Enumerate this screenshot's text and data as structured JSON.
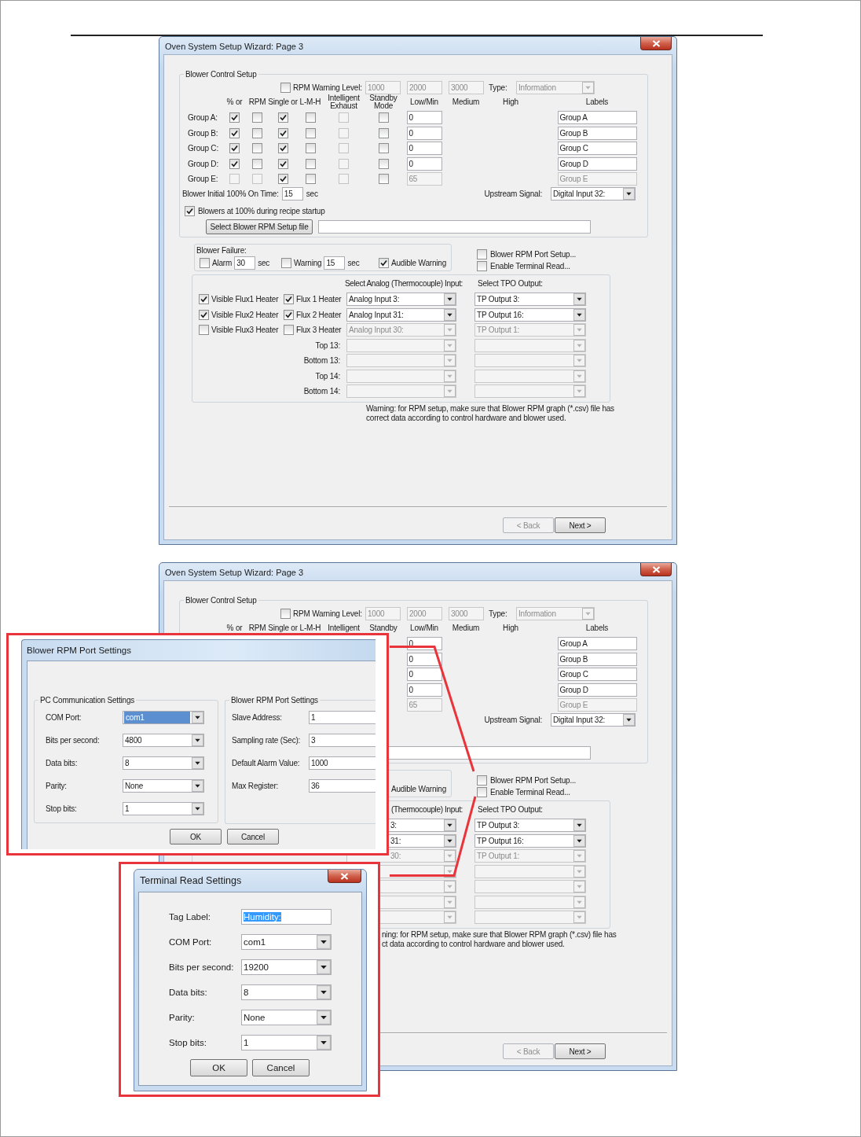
{
  "wizards": [
    {
      "title": "Oven System Setup Wizard: Page 3",
      "blower_control": {
        "legend": "Blower Control Setup",
        "rpm_warning": {
          "checked": false,
          "label": "RPM Warning Level:",
          "levels": [
            {
              "value": "1000",
              "disabled": true
            },
            {
              "value": "2000",
              "disabled": true
            },
            {
              "value": "3000",
              "disabled": true
            }
          ],
          "type_label": "Type:",
          "type_value": {
            "value": "Information",
            "disabled": true
          }
        },
        "headers": [
          "% or",
          "RPM",
          "Single or",
          "L-M-H",
          "Intelligent Exhaust",
          "Standby Mode",
          "Low/Min",
          "Medium",
          "High",
          "Labels"
        ],
        "groups": [
          {
            "name": "Group A:",
            "checks": [
              {
                "checked": true,
                "disabled": false
              },
              {
                "checked": false,
                "disabled": false
              },
              {
                "checked": true,
                "disabled": false
              },
              {
                "checked": false,
                "disabled": false
              },
              {
                "checked": false,
                "disabled": true
              },
              {
                "checked": false,
                "disabled": false
              }
            ],
            "low": {
              "value": "0",
              "disabled": false
            },
            "label": {
              "value": "Group A",
              "disabled": false
            }
          },
          {
            "name": "Group B:",
            "checks": [
              {
                "checked": true,
                "disabled": false
              },
              {
                "checked": false,
                "disabled": false
              },
              {
                "checked": true,
                "disabled": false
              },
              {
                "checked": false,
                "disabled": false
              },
              {
                "checked": false,
                "disabled": true
              },
              {
                "checked": false,
                "disabled": false
              }
            ],
            "low": {
              "value": "0",
              "disabled": false
            },
            "label": {
              "value": "Group B",
              "disabled": false
            }
          },
          {
            "name": "Group C:",
            "checks": [
              {
                "checked": true,
                "disabled": false
              },
              {
                "checked": false,
                "disabled": false
              },
              {
                "checked": true,
                "disabled": false
              },
              {
                "checked": false,
                "disabled": false
              },
              {
                "checked": false,
                "disabled": true
              },
              {
                "checked": false,
                "disabled": false
              }
            ],
            "low": {
              "value": "0",
              "disabled": false
            },
            "label": {
              "value": "Group C",
              "disabled": false
            }
          },
          {
            "name": "Group D:",
            "checks": [
              {
                "checked": true,
                "disabled": false
              },
              {
                "checked": false,
                "disabled": false
              },
              {
                "checked": true,
                "disabled": false
              },
              {
                "checked": false,
                "disabled": false
              },
              {
                "checked": false,
                "disabled": true
              },
              {
                "checked": false,
                "disabled": false
              }
            ],
            "low": {
              "value": "0",
              "disabled": false
            },
            "label": {
              "value": "Group D",
              "disabled": false
            }
          },
          {
            "name": "Group E:",
            "checks": [
              {
                "checked": false,
                "disabled": true
              },
              {
                "checked": false,
                "disabled": true
              },
              {
                "checked": true,
                "disabled": false
              },
              {
                "checked": false,
                "disabled": false
              },
              {
                "checked": false,
                "disabled": true
              },
              {
                "checked": false,
                "disabled": false
              }
            ],
            "low": {
              "value": "65",
              "disabled": true
            },
            "label": {
              "value": "Group E",
              "disabled": true
            }
          }
        ],
        "initial_time": {
          "label": "Blower Initial 100% On Time:",
          "value": "15",
          "unit": "sec"
        },
        "upstream": {
          "label": "Upstream Signal:",
          "value": "Digital Input  32:"
        },
        "startup": {
          "checked": true,
          "label": "Blowers at 100% during recipe startup"
        },
        "setup_file_button": "Select Blower RPM Setup file"
      },
      "blower_failure": {
        "title": "Blower Failure:",
        "alarm": {
          "checked": false,
          "label": "Alarm",
          "value": "30",
          "unit": "sec"
        },
        "warning": {
          "checked": false,
          "label": "Warning",
          "value": "15",
          "unit": "sec"
        },
        "audible": {
          "checked": true,
          "label": "Audible Warning"
        }
      },
      "port_options": [
        {
          "checked": false,
          "label": "Blower RPM Port Setup..."
        },
        {
          "checked": false,
          "label": "Enable Terminal Read..."
        }
      ],
      "heaters": {
        "analog_header": "Select Analog (Thermocouple) Input:",
        "tpo_header": "Select TPO Output:",
        "rows": [
          {
            "visible": {
              "checked": true,
              "label": "Visible Flux1 Heater"
            },
            "flux": {
              "checked": true,
              "label": "Flux 1 Heater"
            },
            "analog": {
              "value": "Analog Input 3:",
              "disabled": false
            },
            "tpo": {
              "value": "TP Output 3:",
              "disabled": false
            }
          },
          {
            "visible": {
              "checked": true,
              "label": "Visible Flux2 Heater"
            },
            "flux": {
              "checked": true,
              "label": "Flux 2 Heater"
            },
            "analog": {
              "value": "Analog Input 31:",
              "disabled": false
            },
            "tpo": {
              "value": "TP Output 16:",
              "disabled": false
            }
          },
          {
            "visible": {
              "checked": false,
              "label": "Visible Flux3 Heater"
            },
            "flux": {
              "checked": false,
              "label": "Flux 3 Heater"
            },
            "analog": {
              "value": "Analog Input 30:",
              "disabled": true
            },
            "tpo": {
              "value": "TP Output 1:",
              "disabled": true
            }
          },
          {
            "label": "Top 13:",
            "analog": {
              "disabled": true
            },
            "tpo": {
              "disabled": true
            }
          },
          {
            "label": "Bottom 13:",
            "analog": {
              "disabled": true
            },
            "tpo": {
              "disabled": true
            }
          },
          {
            "label": "Top 14:",
            "analog": {
              "disabled": true
            },
            "tpo": {
              "disabled": true
            }
          },
          {
            "label": "Bottom 14:",
            "analog": {
              "disabled": true
            },
            "tpo": {
              "disabled": true
            }
          }
        ]
      },
      "warning_lines": [
        "Warning: for RPM setup, make sure that Blower RPM graph (*.csv) file has",
        "correct data according to control hardware and blower used."
      ],
      "buttons": [
        {
          "label": "< Back",
          "disabled": true
        },
        {
          "label": "Next >",
          "disabled": false
        }
      ]
    },
    {
      "title": "Oven System Setup Wizard: Page 3",
      "blower_control": {
        "legend": "Blower Control Setup",
        "rpm_warning": {
          "checked": false,
          "label": "RPM Warning Level:",
          "levels": [
            {
              "value": "1000",
              "disabled": true
            },
            {
              "value": "2000",
              "disabled": true
            },
            {
              "value": "3000",
              "disabled": true
            }
          ],
          "type_label": "Type:",
          "type_value": {
            "value": "Information",
            "disabled": true
          }
        },
        "headers": [
          "% or",
          "RPM",
          "Single or",
          "L-M-H",
          "Intelligent",
          "Standby",
          "Low/Min",
          "Medium",
          "High",
          "Labels"
        ],
        "groups": [
          {
            "low": {
              "value": "0",
              "disabled": false
            },
            "label": {
              "value": "Group A",
              "disabled": false
            }
          },
          {
            "low": {
              "value": "0",
              "disabled": false
            },
            "label": {
              "value": "Group B",
              "disabled": false
            }
          },
          {
            "low": {
              "value": "0",
              "disabled": false
            },
            "label": {
              "value": "Group C",
              "disabled": false
            }
          },
          {
            "low": {
              "value": "0",
              "disabled": false
            },
            "label": {
              "value": "Group D",
              "disabled": false
            }
          },
          {
            "low": {
              "value": "65",
              "disabled": true
            },
            "label": {
              "value": "Group E",
              "disabled": true
            }
          }
        ],
        "upstream": {
          "label": "Upstream Signal:",
          "value": "Digital Input  32:"
        }
      },
      "blower_failure": {
        "audible": {
          "label": "Audible Warning"
        }
      },
      "port_options": [
        {
          "checked": false,
          "label": "Blower RPM Port Setup..."
        },
        {
          "checked": false,
          "label": "Enable Terminal Read..."
        }
      ],
      "heaters": {
        "analog_header": "(Thermocouple) Input:",
        "tpo_header": "Select TPO Output:",
        "rows": [
          {
            "analog": {
              "value": "3:",
              "disabled": false
            },
            "tpo": {
              "value": "TP Output 3:",
              "disabled": false
            }
          },
          {
            "analog": {
              "value": "31:",
              "disabled": false
            },
            "tpo": {
              "value": "TP Output 16:",
              "disabled": false
            }
          },
          {
            "analog": {
              "value": "30:",
              "disabled": true
            },
            "tpo": {
              "value": "TP Output 1:",
              "disabled": true
            }
          },
          {
            "analog": {
              "disabled": true
            },
            "tpo": {
              "disabled": true
            }
          },
          {
            "analog": {
              "disabled": true
            },
            "tpo": {
              "disabled": true
            }
          },
          {
            "analog": {
              "disabled": true
            },
            "tpo": {
              "disabled": true
            }
          },
          {
            "analog": {
              "disabled": true
            },
            "tpo": {
              "disabled": true
            }
          }
        ]
      },
      "warning_lines": [
        "ning: for RPM setup, make sure that Blower RPM graph (*.csv) file has",
        "ct data according to control hardware and blower used."
      ],
      "buttons": [
        {
          "label": "< Back",
          "disabled": true
        },
        {
          "label": "Next >",
          "disabled": false
        }
      ]
    }
  ],
  "port_dialog": {
    "title": "Blower RPM Port Settings",
    "pc_settings": {
      "legend": "PC Communication Settings",
      "fields": [
        {
          "label": "COM Port:",
          "value": "com1",
          "highlighted": true
        },
        {
          "label": "Bits per second:",
          "value": "4800",
          "highlighted": false
        },
        {
          "label": "Data bits:",
          "value": "8",
          "highlighted": false
        },
        {
          "label": "Parity:",
          "value": "None",
          "highlighted": false
        },
        {
          "label": "Stop bits:",
          "value": "1",
          "highlighted": false
        }
      ]
    },
    "rpm_settings": {
      "legend": "Blower RPM Port Settings",
      "fields": [
        {
          "label": "Slave Address:",
          "value": "1"
        },
        {
          "label": "Sampling rate (Sec):",
          "value": "3"
        },
        {
          "label": "Default Alarm Value:",
          "value": "1000"
        },
        {
          "label": "Max Register:",
          "value": "36"
        }
      ]
    },
    "buttons": [
      "OK",
      "Cancel"
    ]
  },
  "terminal_dialog": {
    "title": "Terminal Read Settings",
    "fields": [
      {
        "kind": "text",
        "label": "Tag Label:",
        "value": "Humidity:",
        "highlighted": true
      },
      {
        "kind": "dropdown",
        "label": "COM Port:",
        "value": "com1",
        "highlighted": false
      },
      {
        "kind": "dropdown",
        "label": "Bits per second:",
        "value": "19200",
        "highlighted": false
      },
      {
        "kind": "dropdown",
        "label": "Data bits:",
        "value": "8",
        "highlighted": false
      },
      {
        "kind": "dropdown",
        "label": "Parity:",
        "value": "None",
        "highlighted": false
      },
      {
        "kind": "dropdown",
        "label": "Stop bits:",
        "value": "1",
        "highlighted": false
      }
    ],
    "buttons": [
      "OK",
      "Cancel"
    ]
  }
}
